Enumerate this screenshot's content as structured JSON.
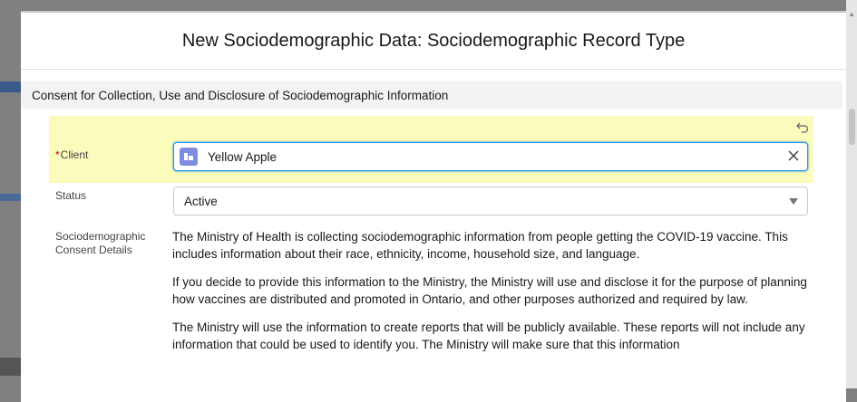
{
  "modal": {
    "title": "New Sociodemographic Data: Sociodemographic Record Type",
    "section_title": "Consent for Collection, Use and Disclosure of Sociodemographic Information"
  },
  "fields": {
    "client": {
      "required_marker": "*",
      "label": "Client",
      "value": "Yellow Apple",
      "icon": "record-icon"
    },
    "status": {
      "label": "Status",
      "value": "Active"
    },
    "consent": {
      "label": "Sociodemographic Consent Details",
      "paragraphs": [
        "The Ministry of Health is collecting sociodemographic information from people getting the COVID-19 vaccine. This includes information about their race, ethnicity, income, household size, and language.",
        "If you decide to provide this information to the Ministry, the Ministry will use and disclose it for the purpose of planning how vaccines are distributed and promoted in Ontario, and other purposes authorized and required by law.",
        "The Ministry will use the information to create reports that will be publicly available. These reports will not include any information that could be used to identify you. The Ministry will make sure that this information"
      ]
    }
  },
  "colors": {
    "highlight": "#fbfbbb",
    "focus_border": "#1b96ff",
    "required": "#ba0517",
    "record_icon": "#7f8de1"
  }
}
